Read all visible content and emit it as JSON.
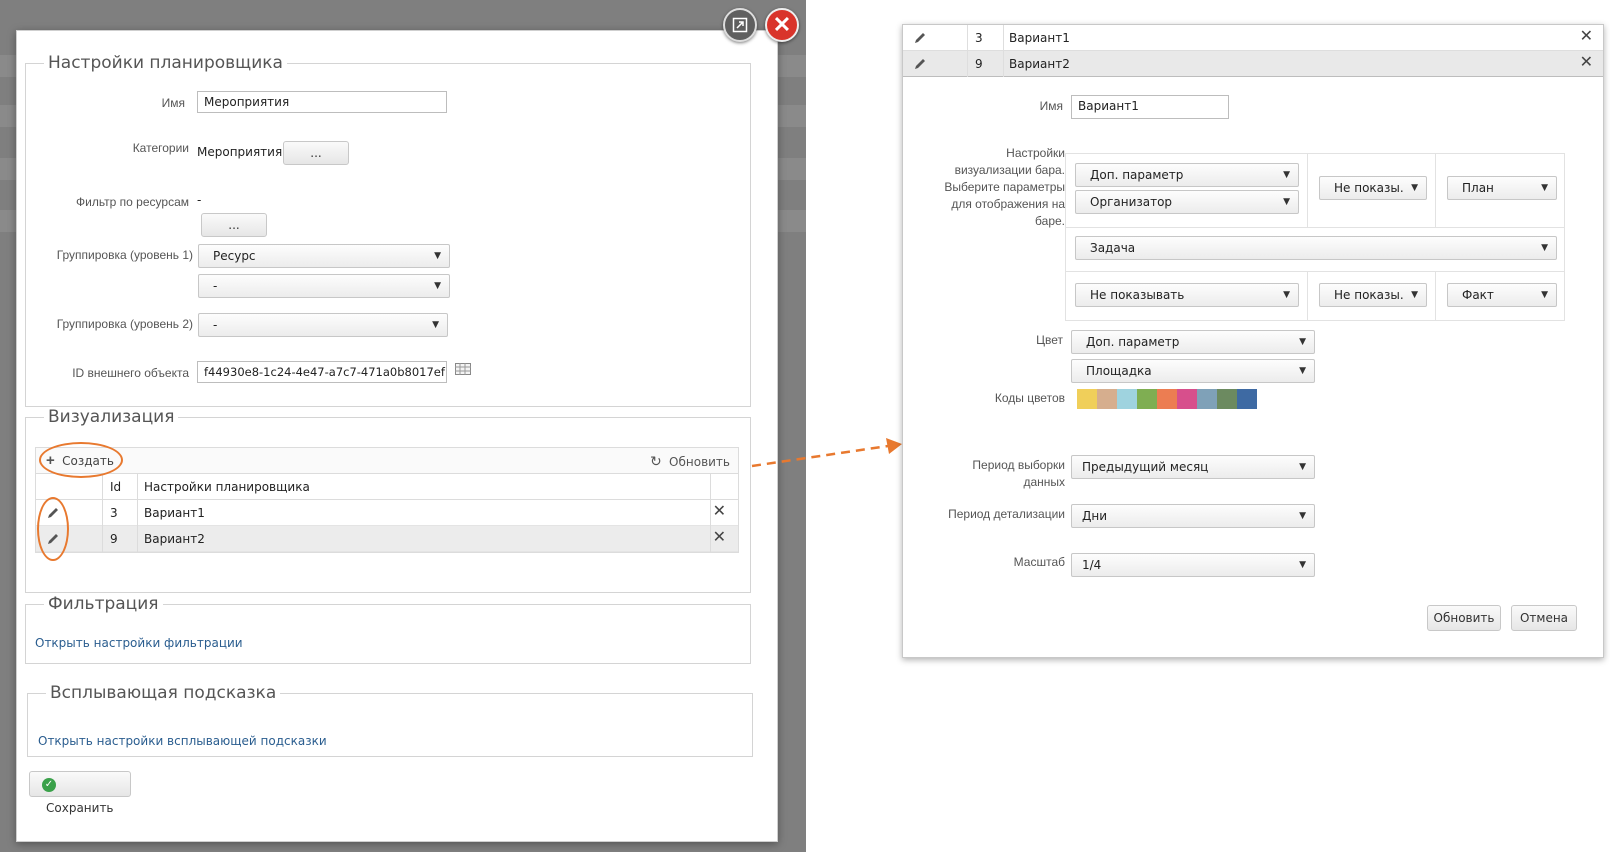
{
  "left": {
    "scheduler_section": {
      "legend": "Настройки планировщика",
      "name_label": "Имя",
      "name_value": "Мероприятия",
      "categories_label": "Категории",
      "categories_value": "Мероприятия;",
      "ellipsis": "...",
      "resource_filter_label": "Фильтр по ресурсам",
      "resource_filter_value": "-",
      "grouping1_label": "Группировка (уровень 1)",
      "grouping1_value": "Ресурс",
      "grouping1_second_value": "-",
      "grouping2_label": "Группировка (уровень 2)",
      "grouping2_value": "-",
      "external_id_label": "ID внешнего объекта",
      "external_id_value": "f44930e8-1c24-4e47-a7c7-471a0b8017ef"
    },
    "visualization_section": {
      "legend": "Визуализация",
      "create_label": "Создать",
      "refresh_label": "Обновить",
      "columns": [
        "Id",
        "Настройки планировщика"
      ],
      "rows": [
        {
          "id": "3",
          "name": "Вариант1"
        },
        {
          "id": "9",
          "name": "Вариант2"
        }
      ]
    },
    "filter_section": {
      "legend": "Фильтрация",
      "link": "Открыть настройки фильтрации"
    },
    "tooltip_section": {
      "legend": "Всплывающая подсказка",
      "link": "Открыть настройки всплывающей подсказки"
    },
    "save_label": "Сохранить"
  },
  "right": {
    "rows": [
      {
        "id": "3",
        "name": "Вариант1"
      },
      {
        "id": "9",
        "name": "Вариант2"
      }
    ],
    "name_label": "Имя",
    "name_value": "Вариант1",
    "bar_settings_label": [
      "Настройки",
      "визуализации бара.",
      "Выберите параметры",
      "для отображения на",
      "баре."
    ],
    "bar": {
      "row1_sel1": "Доп. параметр",
      "row1_sel2": "Организатор",
      "row1_show": "Не показы.",
      "row1_mode": "План",
      "row2_sel": "Задача",
      "row3_sel": "Не показывать",
      "row3_show": "Не показы.",
      "row3_mode": "Факт"
    },
    "color_label": "Цвет",
    "color_sel1": "Доп. параметр",
    "color_sel2": "Площадка",
    "color_codes_label": "Коды цветов",
    "color_codes": [
      "#f0cf5a",
      "#d6ae8e",
      "#9fd3df",
      "#7fae52",
      "#ec7d52",
      "#d74f8c",
      "#7fa1b8",
      "#6c8a60",
      "#3e6aa3"
    ],
    "period_label": [
      "Период выборки",
      "данных"
    ],
    "period_value": "Предыдущий месяц",
    "detail_label": "Период детализации",
    "detail_value": "Дни",
    "scale_label": "Масштаб",
    "scale_value": "1/4",
    "refresh_button": "Обновить",
    "cancel_button": "Отмена"
  },
  "colors": {
    "accent_orange": "#e8792f",
    "close_red": "#d9342b",
    "link_blue": "#2a5d8f",
    "save_green": "#3aa14a"
  }
}
